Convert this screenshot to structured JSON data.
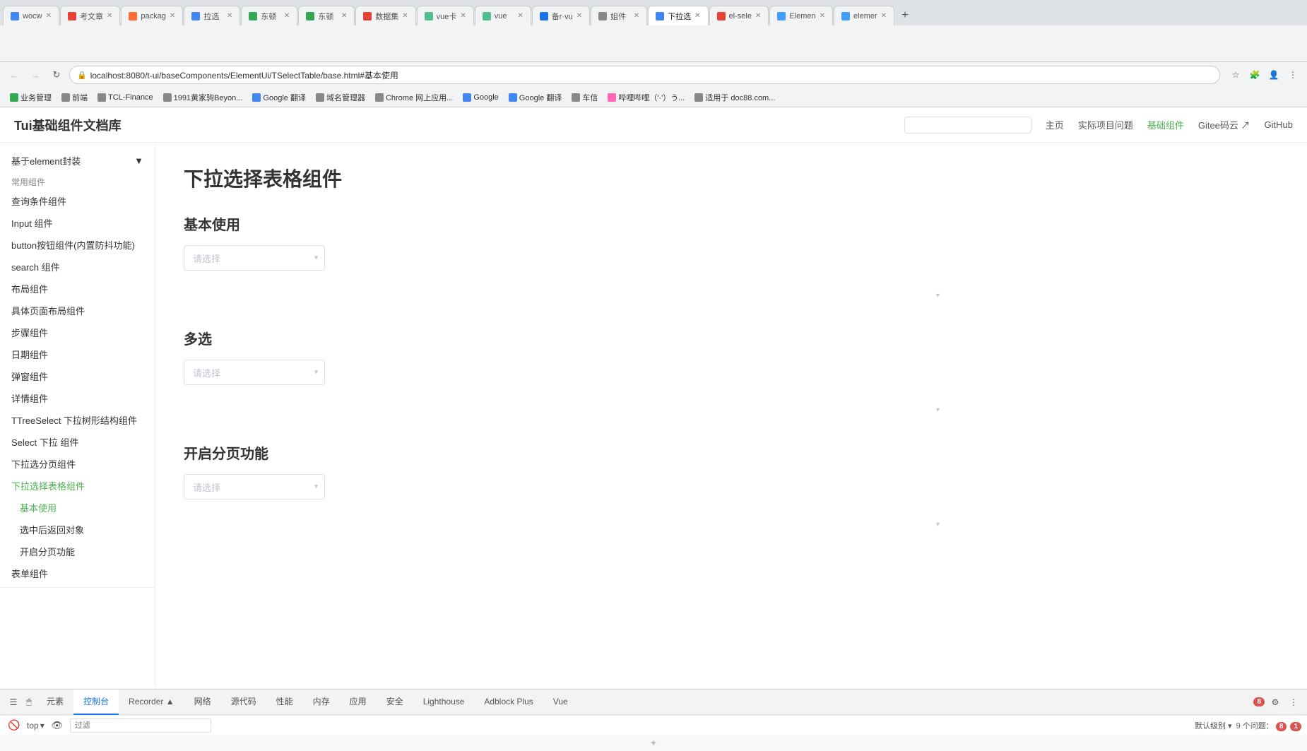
{
  "browser": {
    "tabs": [
      {
        "id": "t1",
        "label": "wocw",
        "favicon_color": "#4285F4",
        "active": false
      },
      {
        "id": "t2",
        "label": "考文章",
        "favicon_color": "#EA4335",
        "active": false
      },
      {
        "id": "t3",
        "label": "packag",
        "favicon_color": "#FF6B35",
        "active": false
      },
      {
        "id": "t4",
        "label": "拉选",
        "favicon_color": "#4285F4",
        "active": false
      },
      {
        "id": "t5",
        "label": "东顿",
        "favicon_color": "#34A853",
        "active": false
      },
      {
        "id": "t6",
        "label": "东顿",
        "favicon_color": "#34A853",
        "active": false
      },
      {
        "id": "t7",
        "label": "数据集",
        "favicon_color": "#EA4335",
        "active": false
      },
      {
        "id": "t8",
        "label": "vue卡",
        "favicon_color": "#4FC08D",
        "active": false
      },
      {
        "id": "t9",
        "label": "vue",
        "favicon_color": "#4FC08D",
        "active": false
      },
      {
        "id": "t10",
        "label": "备r·vu",
        "favicon_color": "#1a73e8",
        "active": false
      },
      {
        "id": "t11",
        "label": "姐件",
        "favicon_color": "#888",
        "active": false
      },
      {
        "id": "t12",
        "label": "下拉选",
        "favicon_color": "#4285F4",
        "active": true
      },
      {
        "id": "t13",
        "label": "el-sele",
        "favicon_color": "#EA4335",
        "active": false
      },
      {
        "id": "t14",
        "label": "Elemen",
        "favicon_color": "#409EFF",
        "active": false
      },
      {
        "id": "t15",
        "label": "elemer",
        "favicon_color": "#409EFF",
        "active": false
      }
    ],
    "address": "localhost:8080/t-ui/baseComponents/ElementUi/TSelectTable/base.html#基本使用",
    "bookmarks": [
      {
        "label": "业务管理",
        "color": "#34A853"
      },
      {
        "label": "前端",
        "color": "#888"
      },
      {
        "label": "TCL-Finance",
        "color": "#888"
      },
      {
        "label": "1991黄家驹Beyon...",
        "color": "#888"
      },
      {
        "label": "Google 翻译",
        "color": "#4285F4"
      },
      {
        "label": "域名管理器",
        "color": "#888"
      },
      {
        "label": "Chrome 网上应用...",
        "color": "#888"
      },
      {
        "label": "Google",
        "color": "#4285F4"
      },
      {
        "label": "Google 翻译",
        "color": "#4285F4"
      },
      {
        "label": "车信",
        "color": "#888"
      },
      {
        "label": "哔哩哔哩（'·'）う...",
        "color": "#FF69B4"
      },
      {
        "label": "适用于 doc88.com...",
        "color": "#888"
      }
    ]
  },
  "header": {
    "logo": "Tui基础组件文档库",
    "search_placeholder": "",
    "nav_items": [
      {
        "label": "主页",
        "active": false
      },
      {
        "label": "实际项目问题",
        "active": false
      },
      {
        "label": "基础组件",
        "active": true
      },
      {
        "label": "Gitee码云 ↗",
        "active": false
      },
      {
        "label": "GitHub",
        "active": false
      }
    ]
  },
  "sidebar": {
    "group_label": "基于element封装",
    "group_expand_icon": "▼",
    "section_label": "常用组件",
    "items": [
      {
        "label": "查询条件组件",
        "sub": false,
        "active": false
      },
      {
        "label": "Input 组件",
        "sub": false,
        "active": false
      },
      {
        "label": "button按钮组件(内置防抖功能)",
        "sub": false,
        "active": false
      },
      {
        "label": "search 组件",
        "sub": false,
        "active": false
      },
      {
        "label": "布局组件",
        "sub": false,
        "active": false
      },
      {
        "label": "具体页面布局组件",
        "sub": false,
        "active": false
      },
      {
        "label": "步骤组件",
        "sub": false,
        "active": false
      },
      {
        "label": "日期组件",
        "sub": false,
        "active": false
      },
      {
        "label": "弹窗组件",
        "sub": false,
        "active": false
      },
      {
        "label": "详情组件",
        "sub": false,
        "active": false
      },
      {
        "label": "TTreeSelect 下拉树形结构组件",
        "sub": false,
        "active": false
      },
      {
        "label": "Select 下拉 组件",
        "sub": false,
        "active": false
      },
      {
        "label": "下拉选分页组件",
        "sub": false,
        "active": false
      },
      {
        "label": "下拉选择表格组件",
        "sub": false,
        "active": true
      },
      {
        "label": "基本使用",
        "sub": true,
        "active": true
      },
      {
        "label": "选中后返回对象",
        "sub": true,
        "active": false
      },
      {
        "label": "开启分页功能",
        "sub": true,
        "active": false
      },
      {
        "label": "表单组件",
        "sub": false,
        "active": false
      }
    ]
  },
  "content": {
    "page_title": "下拉选择表格组件",
    "sections": [
      {
        "title": "基本使用",
        "select_placeholder": "请选择",
        "has_arrow": true
      },
      {
        "title": "多选",
        "select_placeholder": "请选择",
        "has_arrow": true
      },
      {
        "title": "开启分页功能",
        "select_placeholder": "请选择",
        "has_arrow": true
      }
    ]
  },
  "devtools": {
    "tabs": [
      {
        "label": "元素",
        "active": false
      },
      {
        "label": "控制台",
        "active": true
      },
      {
        "label": "Recorder ▲",
        "active": false
      },
      {
        "label": "网络",
        "active": false
      },
      {
        "label": "源代码",
        "active": false
      },
      {
        "label": "性能",
        "active": false
      },
      {
        "label": "内存",
        "active": false
      },
      {
        "label": "应用",
        "active": false
      },
      {
        "label": "安全",
        "active": false
      },
      {
        "label": "Lighthouse",
        "active": false
      },
      {
        "label": "Adblock Plus",
        "active": false
      },
      {
        "label": "Vue",
        "active": false
      }
    ],
    "error_count": "8",
    "top_label": "top",
    "filter_placeholder": "过滤",
    "default_level_label": "默认级别 ▾",
    "issues_label": "9 个问题：",
    "issues_count": "8",
    "issues_flag": "1",
    "cursor_label": ""
  }
}
